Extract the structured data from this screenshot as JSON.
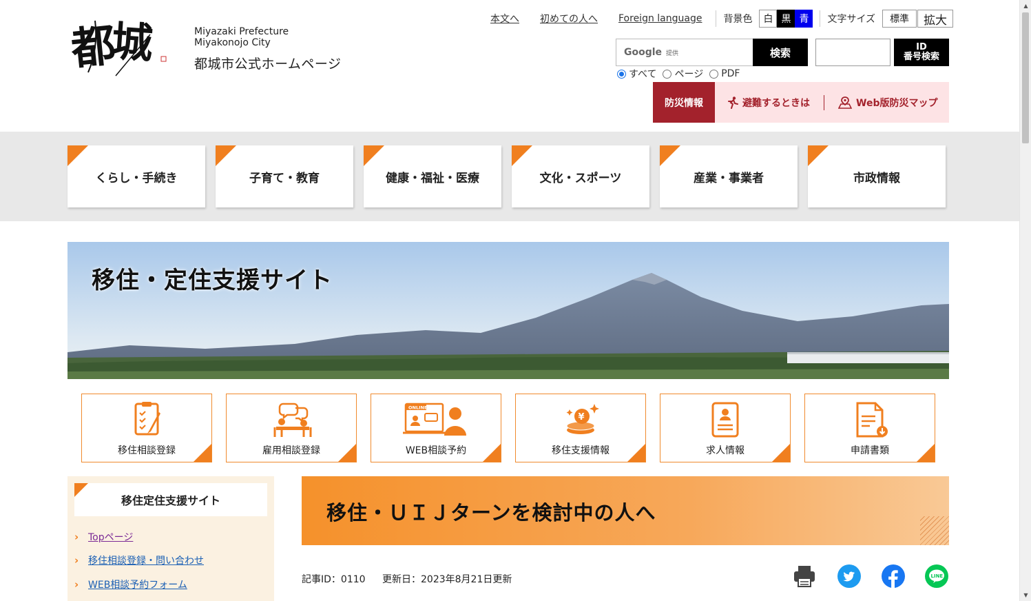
{
  "header": {
    "logo_text": "都城",
    "city_en_line1": "Miyazaki Prefecture",
    "city_en_line2": "Miyakonojo City",
    "city_jp": "都城市公式ホームページ"
  },
  "utility": {
    "skip_link": "本文へ",
    "first_time_link": "初めての人へ",
    "foreign_language_link": "Foreign language",
    "bg_color_label": "背景色",
    "bg_white": "白",
    "bg_black": "黒",
    "bg_blue": "青",
    "font_size_label": "文字サイズ",
    "font_standard": "標準",
    "font_large": "拡大"
  },
  "search": {
    "google_label": "Google",
    "provided_label": "提供",
    "search_button": "検索",
    "id_input_value": "",
    "id_button_line1": "ID",
    "id_button_line2": "番号検索",
    "options": [
      "すべて",
      "ページ",
      "PDF"
    ],
    "selected": "すべて"
  },
  "disaster": {
    "label": "防災情報",
    "evacuate_link": "避難するときは",
    "map_link": "Web版防災マップ"
  },
  "global_nav": [
    "くらし・手続き",
    "子育て・教育",
    "健康・福祉・医療",
    "文化・スポーツ",
    "産業・事業者",
    "市政情報"
  ],
  "hero": {
    "title": "移住・定住支援サイト"
  },
  "quick_links": [
    {
      "label": "移住相談登録",
      "icon": "clipboard-icon"
    },
    {
      "label": "雇用相談登録",
      "icon": "consultation-icon"
    },
    {
      "label": "WEB相談予約",
      "icon": "online-meeting-icon",
      "badge": "ONLINE"
    },
    {
      "label": "移住支援情報",
      "icon": "yen-coins-icon"
    },
    {
      "label": "求人情報",
      "icon": "job-document-icon"
    },
    {
      "label": "申請書類",
      "icon": "download-document-icon"
    }
  ],
  "side_menu": {
    "title": "移住定住支援サイト",
    "links": [
      "Topページ",
      "移住相談登録・問い合わせ",
      "WEB相談予約フォーム"
    ]
  },
  "article": {
    "title": "移住・ＵＩＪターンを検討中の人へ",
    "article_id": "記事ID：0110",
    "updated": "更新日：2023年8月21日更新"
  },
  "share_icons": [
    "print-icon",
    "twitter-icon",
    "facebook-icon",
    "line-icon"
  ],
  "colors": {
    "accent_orange": "#f07f1f",
    "disaster_red": "#a3222c",
    "disaster_bg": "#fde3e5",
    "nav_bg": "#e8e8e8",
    "side_bg": "#fbf1e1"
  }
}
